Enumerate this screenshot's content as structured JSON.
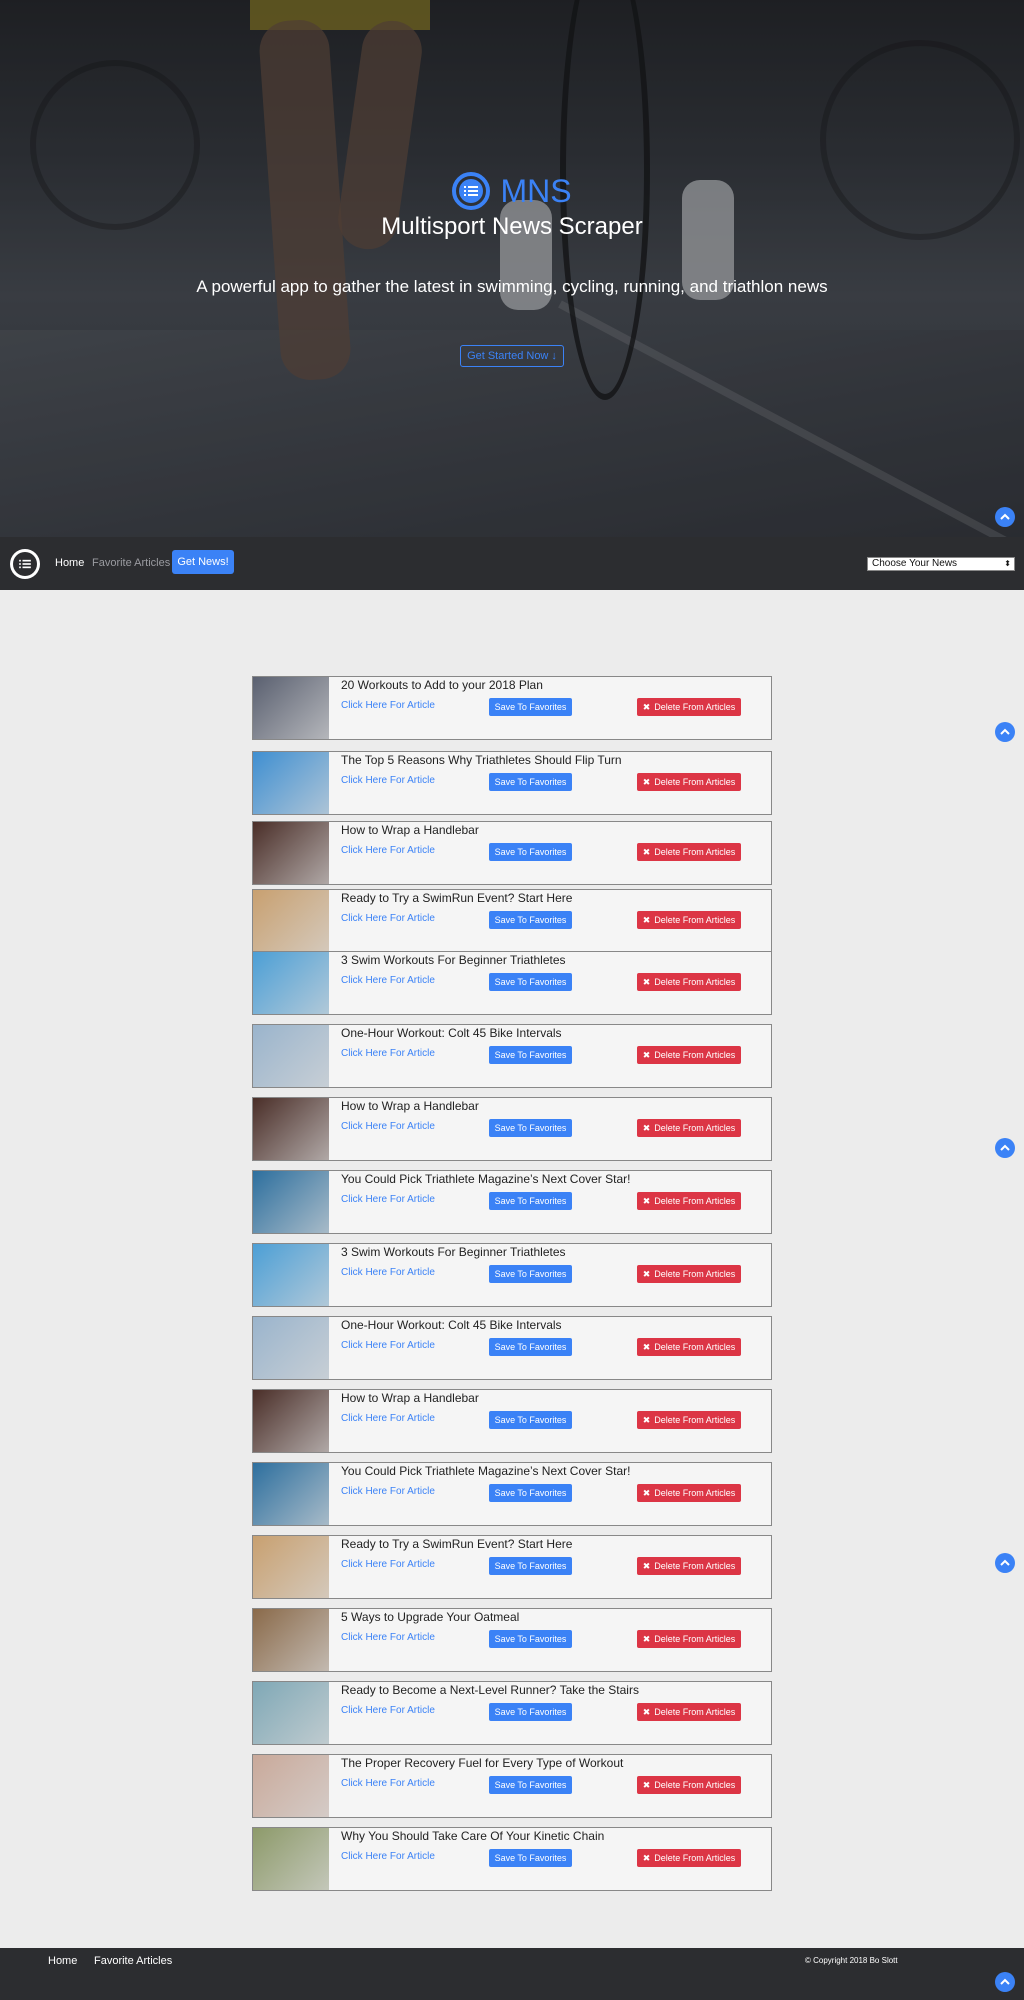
{
  "hero": {
    "brand": "MNS",
    "title": "Multisport News Scraper",
    "subtitle": "A powerful app to gather the latest in swimming, cycling, running, and triathlon news",
    "cta_label": "Get Started Now ↓"
  },
  "nav": {
    "home": "Home",
    "favorites": "Favorite Articles",
    "get_news": "Get News!",
    "select_value": "Choose Your News"
  },
  "articles": {
    "link_label": "Click Here For Article",
    "save_label": "Save To Favorites",
    "delete_label": "Delete From Articles",
    "items": [
      {
        "title": "20 Workouts to Add to your 2018 Plan",
        "thumb_color": "#5a6070"
      },
      {
        "title": "The Top 5 Reasons Why Triathletes Should Flip Turn",
        "thumb_color": "#3f8fd1"
      },
      {
        "title": "How to Wrap a Handlebar",
        "thumb_color": "#4a2e28"
      },
      {
        "title": "Ready to Try a SwimRun Event? Start Here",
        "thumb_color": "#c8a070"
      },
      {
        "title": "3 Swim Workouts For Beginner Triathletes",
        "thumb_color": "#4c9fd6"
      },
      {
        "title": "One-Hour Workout: Colt 45 Bike Intervals",
        "thumb_color": "#9ab4cc"
      },
      {
        "title": "How to Wrap a Handlebar",
        "thumb_color": "#4a2e28"
      },
      {
        "title": "You Could Pick Triathlete Magazine’s Next Cover Star!",
        "thumb_color": "#2d6f9e"
      },
      {
        "title": "3 Swim Workouts For Beginner Triathletes",
        "thumb_color": "#4c9fd6"
      },
      {
        "title": "One-Hour Workout: Colt 45 Bike Intervals",
        "thumb_color": "#9ab4cc"
      },
      {
        "title": "How to Wrap a Handlebar",
        "thumb_color": "#4a2e28"
      },
      {
        "title": "You Could Pick Triathlete Magazine’s Next Cover Star!",
        "thumb_color": "#2d6f9e"
      },
      {
        "title": "Ready to Try a SwimRun Event? Start Here",
        "thumb_color": "#c8a070"
      },
      {
        "title": "5 Ways to Upgrade Your Oatmeal",
        "thumb_color": "#8a6a4a"
      },
      {
        "title": "Ready to Become a Next-Level Runner? Take the Stairs",
        "thumb_color": "#7fa8b6"
      },
      {
        "title": "The Proper Recovery Fuel for Every Type of Workout",
        "thumb_color": "#c9a99a"
      },
      {
        "title": "Why You Should Take Care Of Your Kinetic Chain",
        "thumb_color": "#8d9a6a"
      }
    ]
  },
  "footer": {
    "home": "Home",
    "favorites": "Favorite Articles",
    "copyright": "© Copyright 2018 Bo Slott"
  },
  "colors": {
    "accent": "#3b82f6",
    "danger": "#dc3545",
    "dark": "#2c2d30"
  }
}
